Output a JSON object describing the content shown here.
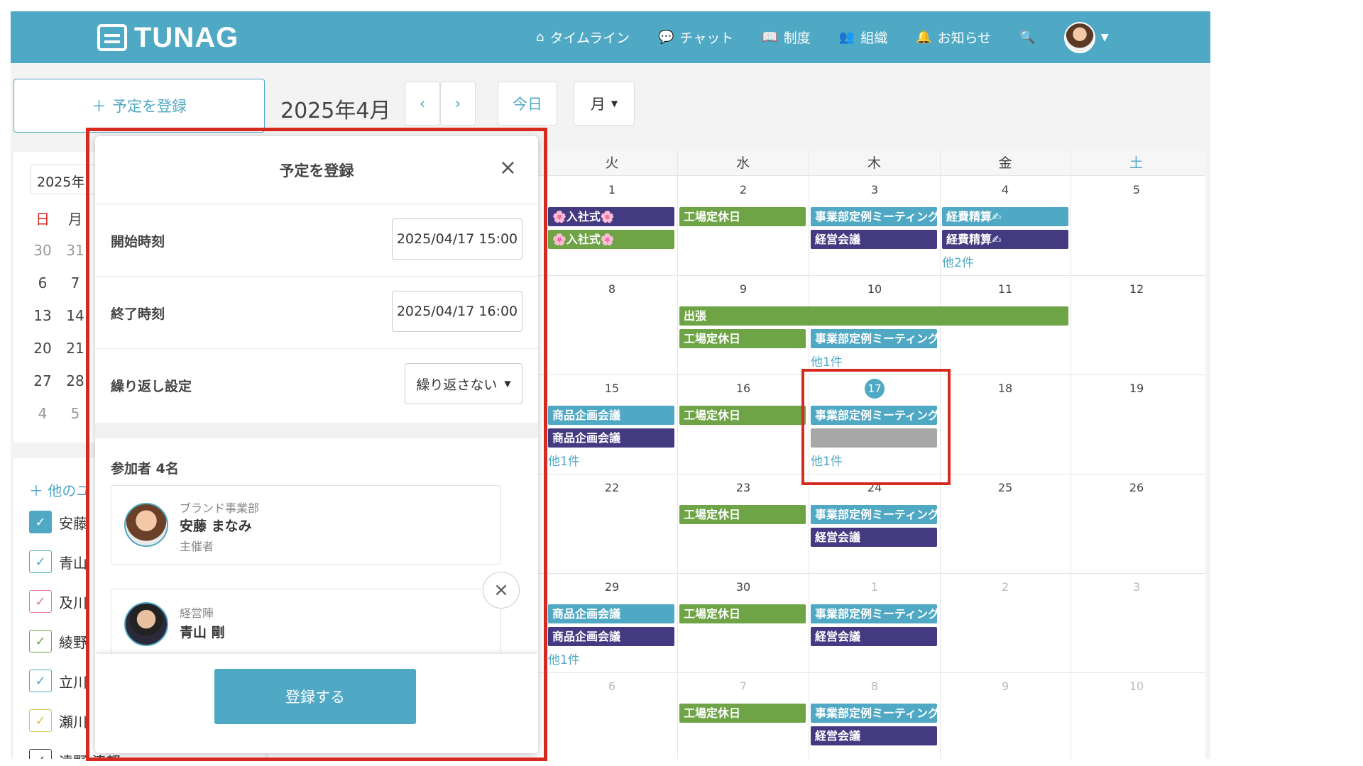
{
  "header": {
    "logo": "TUNAG",
    "nav": [
      {
        "icon": "home-icon",
        "glyph": "⌂",
        "label": "タイムライン"
      },
      {
        "icon": "chat-icon",
        "glyph": "💬",
        "label": "チャット"
      },
      {
        "icon": "book-icon",
        "glyph": "📖",
        "label": "制度"
      },
      {
        "icon": "users-icon",
        "glyph": "👥",
        "label": "組織"
      },
      {
        "icon": "bell-icon",
        "glyph": "🔔",
        "label": "お知らせ"
      }
    ],
    "search_glyph": "🔍"
  },
  "toolbar": {
    "add_label": "予定を登録",
    "month": "2025年4月",
    "prev": "‹",
    "next": "›",
    "today": "今日",
    "view": "月"
  },
  "sidebar": {
    "year": "2025年",
    "weekday_heads": [
      "日",
      "月"
    ],
    "mini_rows": [
      [
        "30",
        "31"
      ],
      [
        "6",
        "7"
      ],
      [
        "13",
        "14"
      ],
      [
        "20",
        "21"
      ],
      [
        "27",
        "28"
      ],
      [
        "4",
        "5"
      ]
    ],
    "others_label": "他のユ",
    "members": [
      {
        "name": "安藤",
        "checked": true,
        "color": "#4fa8c4"
      },
      {
        "name": "青山",
        "checked": false,
        "color": "#4fa8c4"
      },
      {
        "name": "及川",
        "checked": false,
        "color": "#e07aa0"
      },
      {
        "name": "綾野",
        "checked": false,
        "color": "#6ea446"
      },
      {
        "name": "立川",
        "checked": false,
        "color": "#4fa8c4"
      },
      {
        "name": "瀬川",
        "checked": false,
        "color": "#d7c24a"
      },
      {
        "name": "遠野 湊都",
        "checked": false,
        "color": "#444"
      }
    ]
  },
  "calendar": {
    "day_names": [
      "火",
      "水",
      "木",
      "金",
      "土"
    ],
    "weeks": [
      [
        "1",
        "2",
        "3",
        "4",
        "5"
      ],
      [
        "8",
        "9",
        "10",
        "11",
        "12"
      ],
      [
        "15",
        "16",
        "17",
        "18",
        "19"
      ],
      [
        "22",
        "23",
        "24",
        "25",
        "26"
      ],
      [
        "29",
        "30",
        "1",
        "2",
        "3"
      ],
      [
        "6",
        "7",
        "8",
        "9",
        "10"
      ]
    ],
    "events": {
      "nyusha_1": "🌸入社式🌸",
      "nyusha_2": "🌸入社式🌸",
      "kojo_2": "工場定休日",
      "jigyo_3": "事業部定例ミーティング",
      "keiei_3": "経営会議",
      "keihi_4a": "経費精算✍",
      "keihi_4b": "経費精算✍",
      "more_4": "他2件",
      "shutcho": "出張",
      "kojo_9": "工場定休日",
      "jigyo_10": "事業部定例ミーティング",
      "more_10": "他1件",
      "shohin_15a": "商品企画会議",
      "shohin_15b": "商品企画会議",
      "more_15": "他1件",
      "kojo_16": "工場定休日",
      "jigyo_17": "事業部定例ミーティング",
      "more_17": "他1件",
      "kojo_23": "工場定休日",
      "jigyo_24": "事業部定例ミーティング",
      "keiei_24": "経営会議",
      "shohin_29a": "商品企画会議",
      "shohin_29b": "商品企画会議",
      "more_29": "他1件",
      "kojo_30": "工場定休日",
      "jigyo_1": "事業部定例ミーティング",
      "keiei_1": "経営会議",
      "kojo_7": "工場定休日",
      "jigyo_8": "事業部定例ミーティング",
      "keiei_8": "経営会議"
    }
  },
  "popup": {
    "title": "予定を登録",
    "close": "×",
    "start_label": "開始時刻",
    "start_value": "2025/04/17 15:00",
    "end_label": "終了時刻",
    "end_value": "2025/04/17 16:00",
    "repeat_label": "繰り返し設定",
    "repeat_value": "繰り返さない",
    "participants_label": "参加者 4名",
    "participants": [
      {
        "dept": "ブランド事業部",
        "name": "安藤 まなみ",
        "role": "主催者"
      },
      {
        "dept": "経営陣",
        "name": "青山 剛",
        "role": ""
      }
    ],
    "submit": "登録する"
  },
  "colors": {
    "accent": "#4fa8c4",
    "highlight": "#d62a21"
  }
}
